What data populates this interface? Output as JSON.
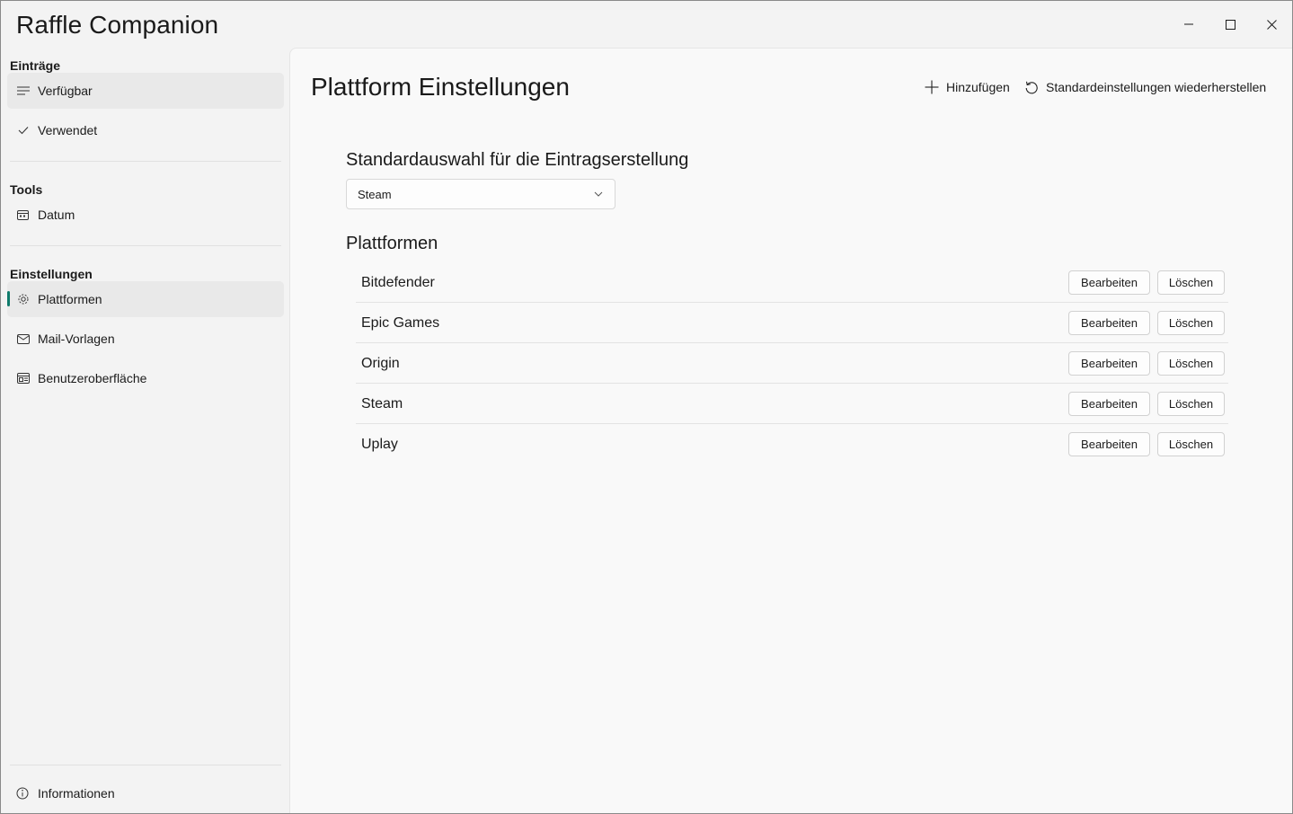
{
  "app": {
    "title": "Raffle Companion"
  },
  "window_controls": {
    "minimize": "minimize-icon",
    "maximize": "maximize-icon",
    "close": "close-icon"
  },
  "sidebar": {
    "sections": [
      {
        "header": "Einträge",
        "items": [
          {
            "label": "Verfügbar",
            "icon": "list-icon",
            "selected": true
          },
          {
            "label": "Verwendet",
            "icon": "checkmark-icon",
            "selected": false
          }
        ]
      },
      {
        "header": "Tools",
        "items": [
          {
            "label": "Datum",
            "icon": "calendar-icon",
            "selected": false
          }
        ]
      },
      {
        "header": "Einstellungen",
        "items": [
          {
            "label": "Plattformen",
            "icon": "gear-icon",
            "selected": true
          },
          {
            "label": "Mail-Vorlagen",
            "icon": "mail-icon",
            "selected": false
          },
          {
            "label": "Benutzeroberfläche",
            "icon": "layout-icon",
            "selected": false
          }
        ]
      }
    ],
    "footer": {
      "label": "Informationen",
      "icon": "info-icon"
    }
  },
  "main": {
    "title": "Plattform Einstellungen",
    "commands": {
      "add": "Hinzufügen",
      "reset": "Standardeinstellungen wiederherstellen"
    },
    "default_section": {
      "title": "Standardauswahl für die Eintragserstellung",
      "selected": "Steam"
    },
    "platforms_section": {
      "title": "Plattformen",
      "edit_label": "Bearbeiten",
      "delete_label": "Löschen",
      "items": [
        "Bitdefender",
        "Epic Games",
        "Origin",
        "Steam",
        "Uplay"
      ]
    }
  },
  "colors": {
    "accent": "#0f7b6c",
    "background": "#f3f3f3",
    "content": "#f9f9f9"
  }
}
